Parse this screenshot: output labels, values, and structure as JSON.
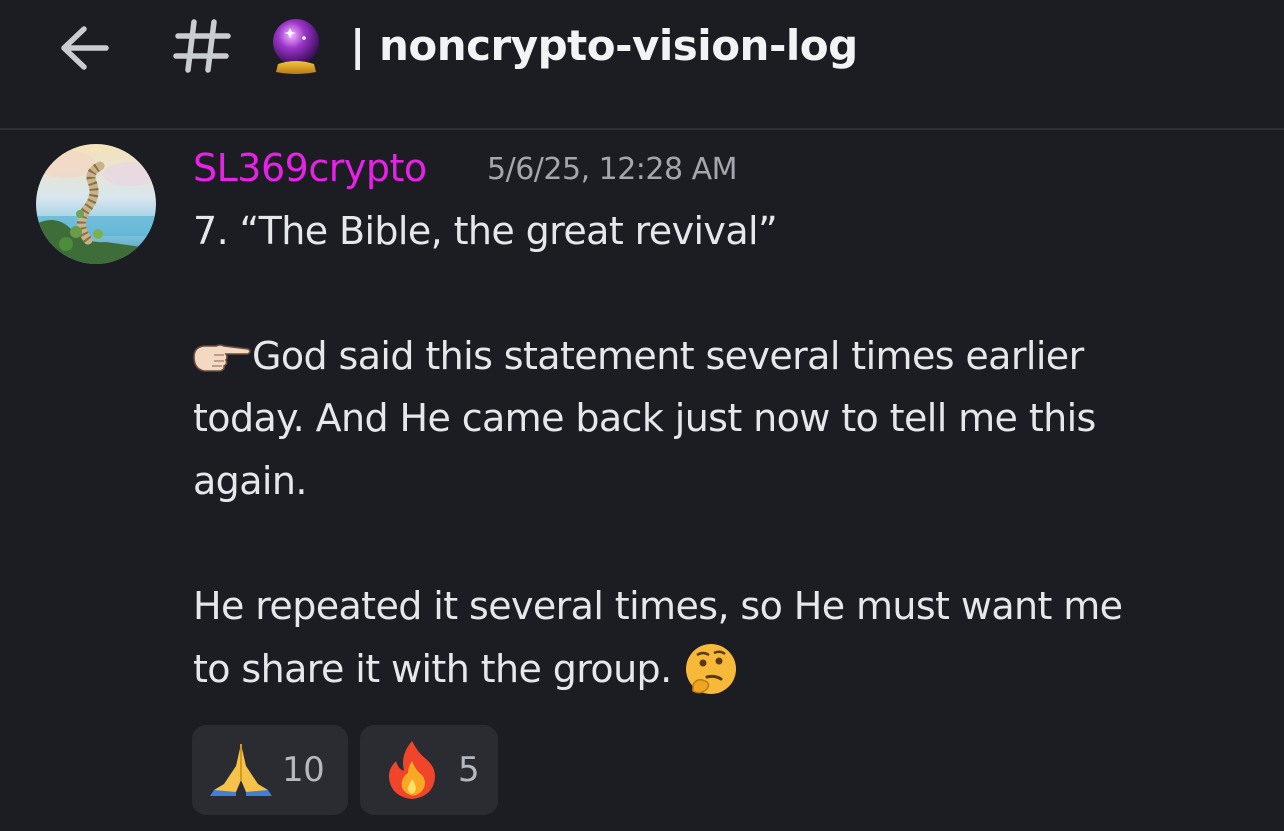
{
  "header": {
    "back_icon": "arrow-left-icon",
    "channel_icon": "hash-icon",
    "channel_emoji": "crystal-ball-icon",
    "channel_name": "| noncrypto-vision-log"
  },
  "message": {
    "avatar": "stairway-to-heaven-avatar",
    "author": "SL369crypto",
    "author_color": "#e820e8",
    "timestamp": "5/6/25, 12:28 AM",
    "lines": {
      "l1": "7.  “The Bible, the great revival”",
      "l2": "God said this statement several times earlier",
      "l3": "today. And He came back just now to tell me this",
      "l4": "again.",
      "l5": "He repeated it several times, so He must want me",
      "l6": "to share it with the group. "
    },
    "inline_icons": [
      "pointing-finger-icon",
      "thinking-face-icon"
    ]
  },
  "reactions": [
    {
      "icon": "folded-hands-icon",
      "count": "10"
    },
    {
      "icon": "fire-icon",
      "count": "5"
    }
  ],
  "colors": {
    "background": "#1c1d22",
    "reaction_bg": "#2a2c32",
    "text": "#e6e7ea",
    "muted": "#a3a6ad"
  }
}
